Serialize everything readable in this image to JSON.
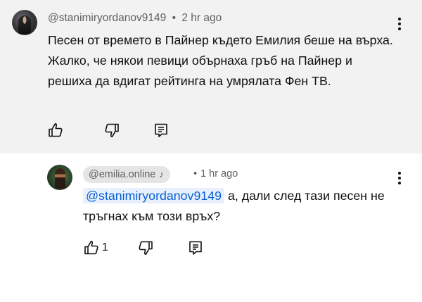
{
  "top_comment": {
    "handle": "@stanimiryordanov9149",
    "separator": "•",
    "time": "2 hr ago",
    "text": "Песен от времето в Пайнер където Емилия беше на върха. Жалко, че някои певици обърнаха гръб на Пайнер и решиха да вдигат рейтинга на умрялата Фен ТВ.",
    "icons": {
      "like": "thumbs-up-icon",
      "dislike": "thumbs-down-icon",
      "reply": "reply-comment-icon",
      "menu": "more-vert-icon"
    }
  },
  "reply_comment": {
    "author": "@emilia.online",
    "author_badge": "♪",
    "separator": "•",
    "time": "1 hr ago",
    "mention": "@stanimiryordanov9149",
    "text": " а, дали след тази песен не тръгнах към този връх?",
    "like_count": "1",
    "icons": {
      "like": "thumbs-up-icon",
      "dislike": "thumbs-down-icon",
      "reply": "reply-comment-icon",
      "menu": "more-vert-icon",
      "badge": "music-note-icon"
    }
  }
}
